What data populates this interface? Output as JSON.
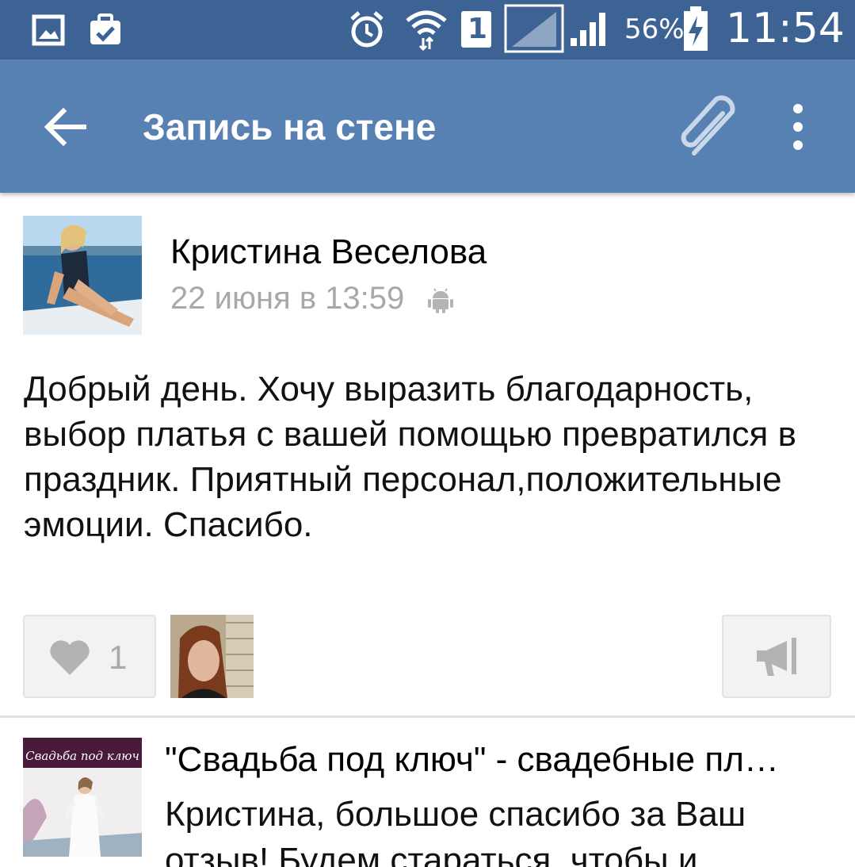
{
  "status_bar": {
    "battery_percent": "56%",
    "time": "11:54",
    "sim_slot": "1",
    "icons": [
      "gallery-icon",
      "clipboard-check-icon",
      "alarm-icon",
      "wifi-icon",
      "sim-1-icon",
      "signal-empty-icon",
      "signal-icon",
      "battery-charging-icon"
    ]
  },
  "app_bar": {
    "title": "Запись на стене",
    "icons": [
      "back-arrow-icon",
      "paperclip-icon",
      "more-vert-icon"
    ]
  },
  "post": {
    "author": "Кристина Веселова",
    "date": "22 июня в 13:59",
    "platform_icon": "android-icon",
    "text": "Добрый день. Хочу выразить благодарность, выбор платья с вашей помощью превратился в праздник. Приятный персонал,положительные эмоции. Спасибо.",
    "likes": "1",
    "like_icon": "heart-icon",
    "share_icon": "megaphone-icon"
  },
  "comment": {
    "author": "\"Свадьба под ключ\" - свадебные пл…",
    "avatar_logo_text": "Свадьба под ключ",
    "text": "Кристина, большое спасибо за Ваш отзыв! Будем стараться, чтобы и"
  },
  "colors": {
    "status_bar": "#3d6394",
    "app_bar": "#5781b3",
    "date_gray": "#a8a8a8",
    "button_bg": "#f2f2f2"
  }
}
